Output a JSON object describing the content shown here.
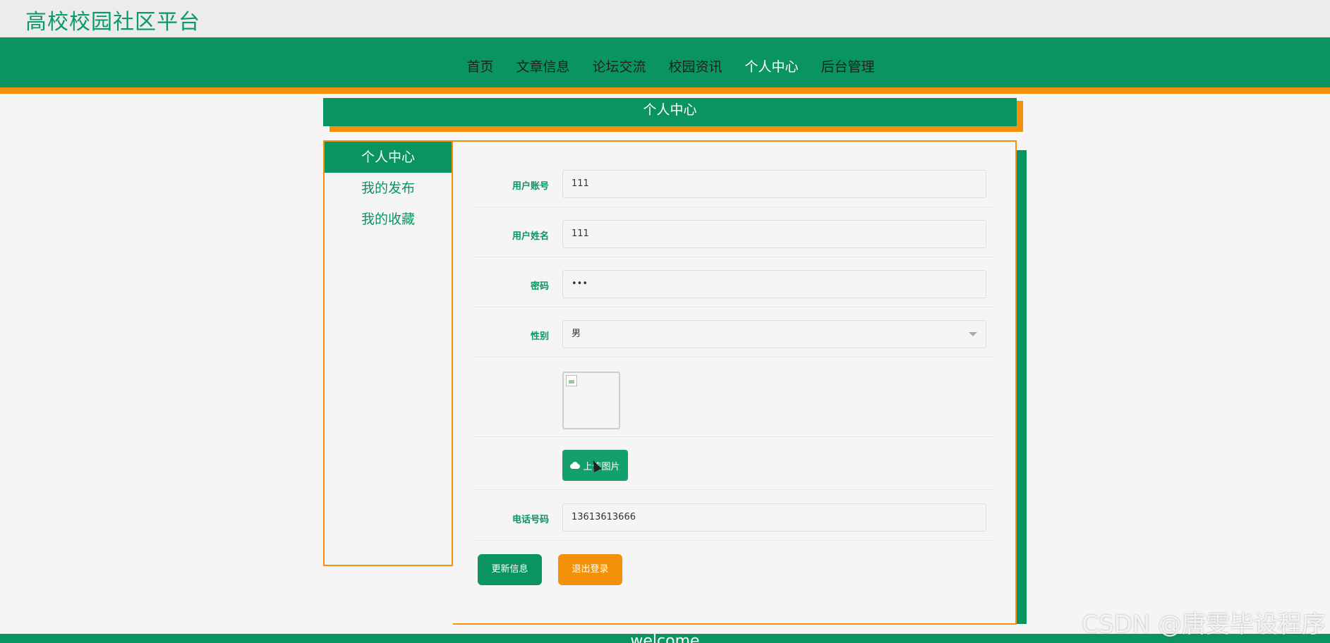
{
  "site": {
    "title": "高校校园社区平台"
  },
  "nav": {
    "items": [
      {
        "label": "首页"
      },
      {
        "label": "文章信息"
      },
      {
        "label": "论坛交流"
      },
      {
        "label": "校园资讯"
      },
      {
        "label": "个人中心",
        "active": true
      },
      {
        "label": "后台管理"
      }
    ]
  },
  "section": {
    "title": "个人中心"
  },
  "sidebar": {
    "items": [
      {
        "label": "个人中心",
        "active": true
      },
      {
        "label": "我的发布"
      },
      {
        "label": "我的收藏"
      }
    ]
  },
  "form": {
    "account": {
      "label": "用户账号",
      "value": "111"
    },
    "name": {
      "label": "用户姓名",
      "value": "111"
    },
    "password": {
      "label": "密码",
      "value": "•••"
    },
    "gender": {
      "label": "性别",
      "value": "男"
    },
    "upload": {
      "label": "上传图片"
    },
    "phone": {
      "label": "电话号码",
      "value": "13613613666"
    }
  },
  "actions": {
    "update": "更新信息",
    "logout": "退出登录"
  },
  "footer": {
    "text": "welcome"
  },
  "watermark": "CSDN @唐雯毕设程序",
  "colors": {
    "primary": "#0a9560",
    "accent": "#f5900a",
    "background": "#f5f5f5"
  }
}
